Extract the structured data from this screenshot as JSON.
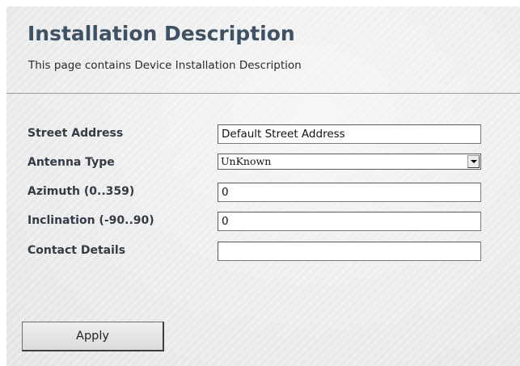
{
  "header": {
    "title": "Installation Description",
    "subtitle": "This page contains Device Installation Description"
  },
  "form": {
    "street_address": {
      "label": "Street Address",
      "value": "Default Street Address"
    },
    "antenna_type": {
      "label": "Antenna Type",
      "selected": "UnKnown"
    },
    "azimuth": {
      "label": "Azimuth (0..359)",
      "value": "0"
    },
    "inclination": {
      "label": "Inclination (-90..90)",
      "value": "0"
    },
    "contact_details": {
      "label": "Contact Details",
      "value": ""
    }
  },
  "actions": {
    "apply_label": "Apply"
  }
}
